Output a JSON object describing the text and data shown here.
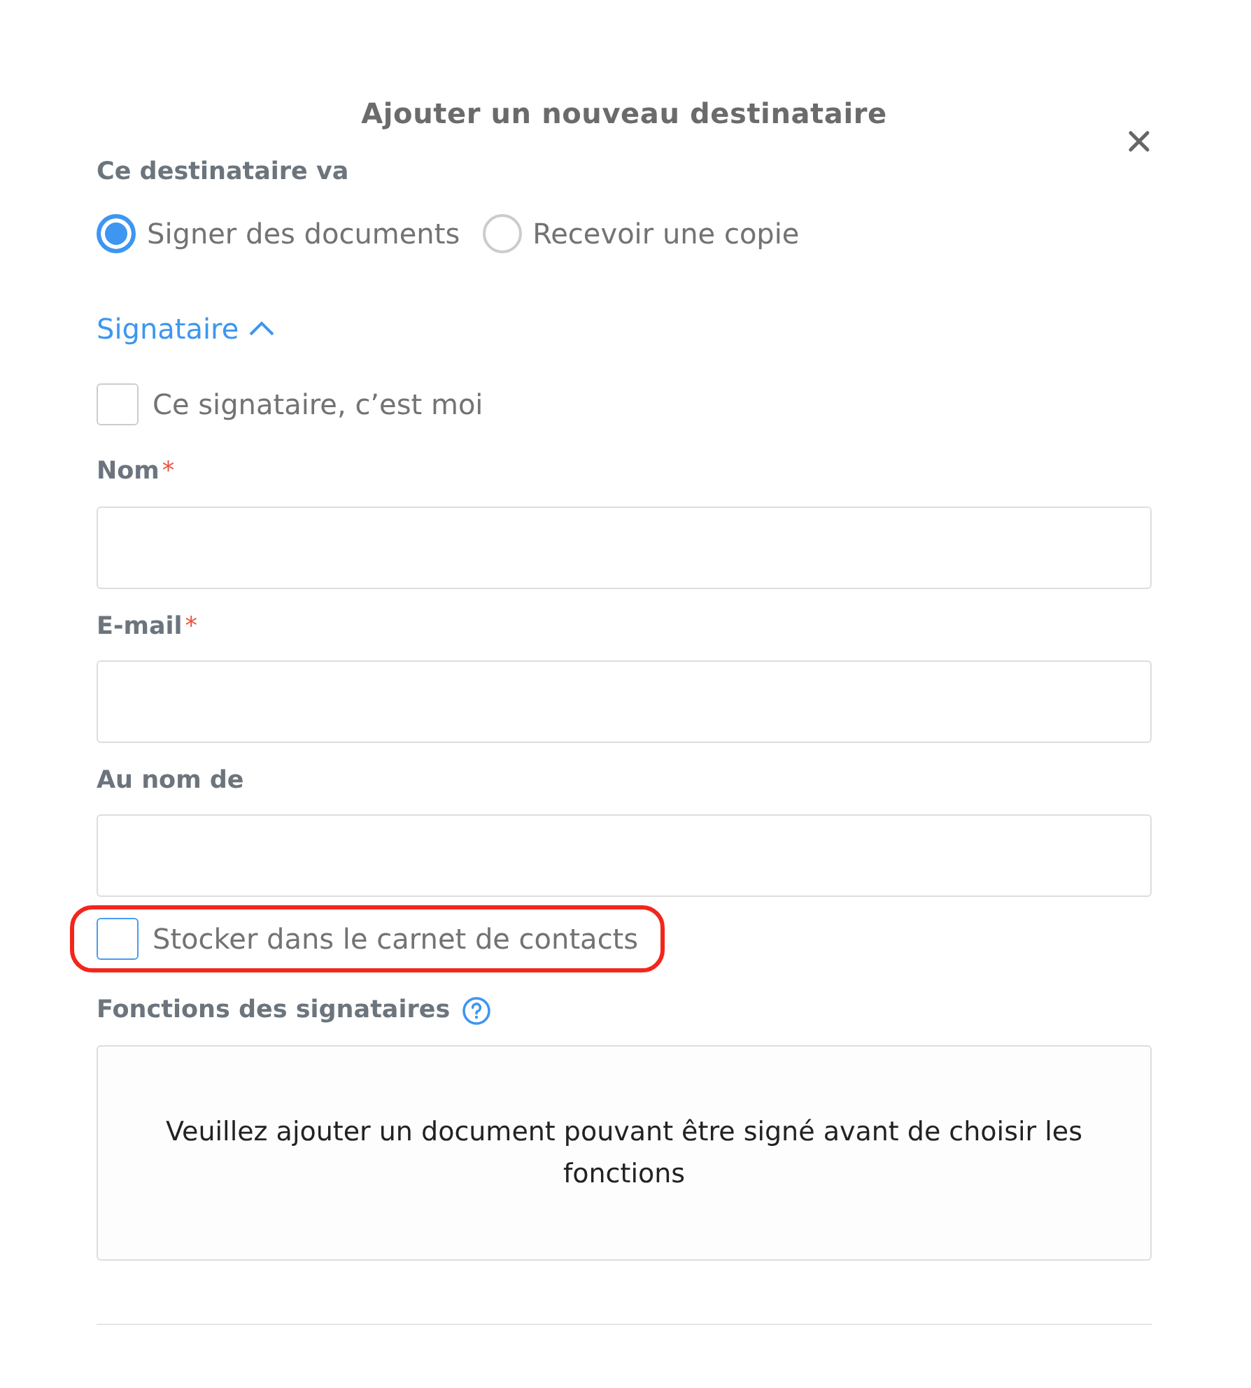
{
  "dialog": {
    "title": "Ajouter un nouveau destinataire"
  },
  "role": {
    "label": "Ce destinataire va",
    "options": [
      {
        "label": "Signer des documents",
        "selected": true
      },
      {
        "label": "Recevoir une copie",
        "selected": false
      }
    ]
  },
  "section": {
    "label": "Signataire",
    "expanded": true
  },
  "self_checkbox": {
    "label": "Ce signataire, c’est moi",
    "checked": false
  },
  "fields": [
    {
      "label": "Nom",
      "required_mark": "*"
    },
    {
      "label": "E-mail",
      "required_mark": "*"
    },
    {
      "label": "Au nom de"
    }
  ],
  "store_checkbox": {
    "label": "Stocker dans le carnet de contacts",
    "checked": false,
    "highlighted": true
  },
  "functions": {
    "label": "Fonctions des signataires",
    "message": "Veuillez ajouter un document pouvant être signé avant de choisir les fonctions"
  }
}
